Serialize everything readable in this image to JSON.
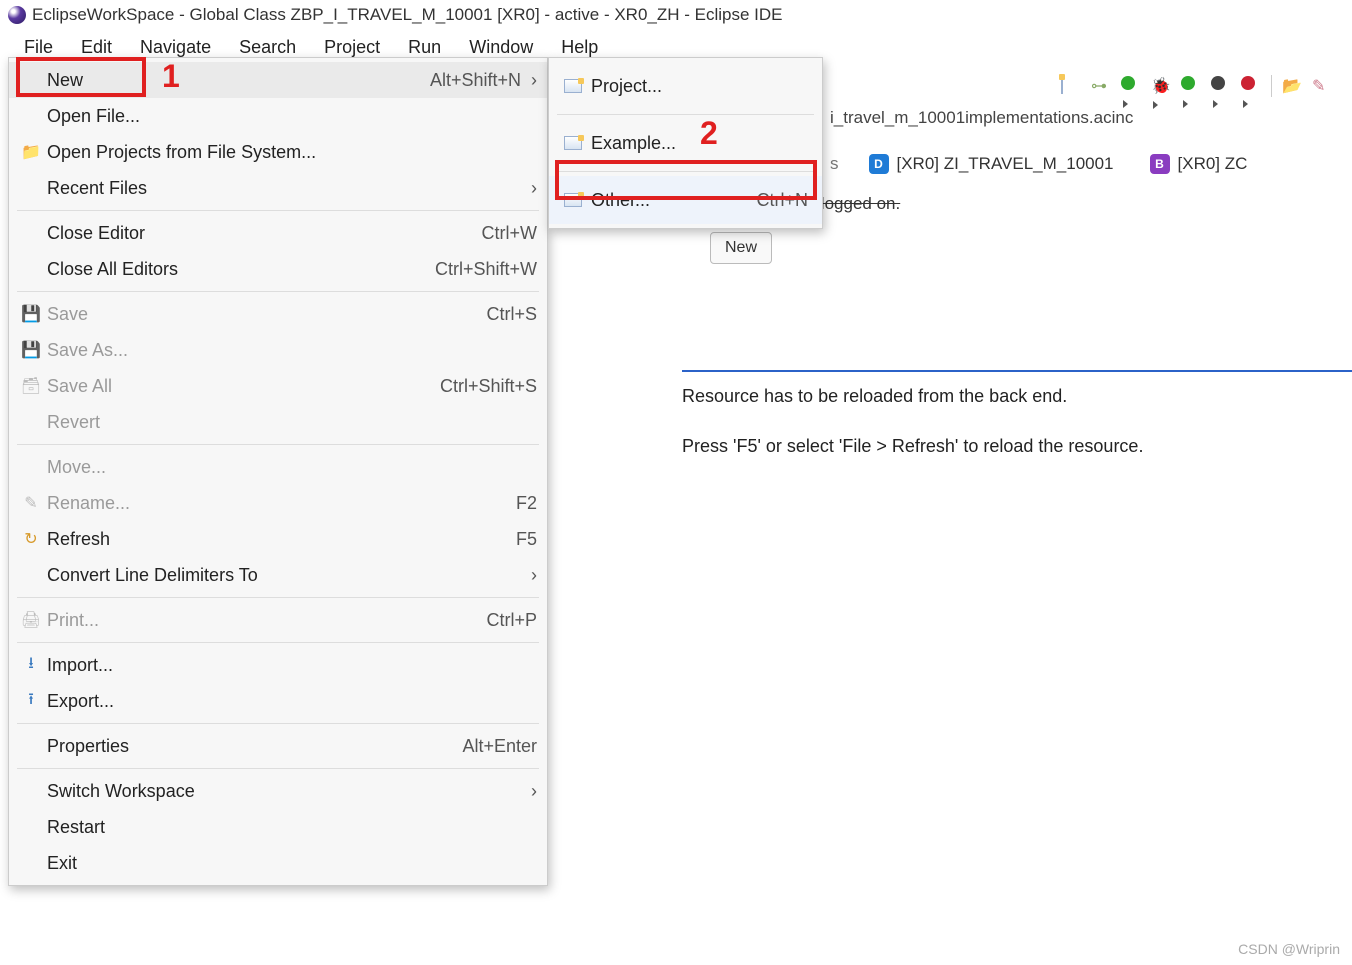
{
  "title_bar": "EclipseWorkSpace - Global Class ZBP_I_TRAVEL_M_10001 [XR0]  - active - XR0_ZH - Eclipse IDE",
  "menu_bar": [
    "File",
    "Edit",
    "Navigate",
    "Search",
    "Project",
    "Run",
    "Window",
    "Help"
  ],
  "file_menu": {
    "items": [
      {
        "icon": "",
        "label": "New",
        "shortcut": "Alt+Shift+N",
        "arrow": ">",
        "enabled": true,
        "highlight": true
      },
      {
        "icon": "",
        "label": "Open File...",
        "shortcut": "",
        "arrow": "",
        "enabled": true
      },
      {
        "icon": "folder",
        "label": "Open Projects from File System...",
        "shortcut": "",
        "arrow": "",
        "enabled": true
      },
      {
        "icon": "",
        "label": "Recent Files",
        "shortcut": "",
        "arrow": ">",
        "enabled": true
      },
      {
        "sep": true
      },
      {
        "icon": "",
        "label": "Close Editor",
        "shortcut": "Ctrl+W",
        "arrow": "",
        "enabled": true
      },
      {
        "icon": "",
        "label": "Close All Editors",
        "shortcut": "Ctrl+Shift+W",
        "arrow": "",
        "enabled": true
      },
      {
        "sep": true
      },
      {
        "icon": "save",
        "label": "Save",
        "shortcut": "Ctrl+S",
        "arrow": "",
        "enabled": false
      },
      {
        "icon": "saveas",
        "label": "Save As...",
        "shortcut": "",
        "arrow": "",
        "enabled": false
      },
      {
        "icon": "saveall",
        "label": "Save All",
        "shortcut": "Ctrl+Shift+S",
        "arrow": "",
        "enabled": false
      },
      {
        "icon": "",
        "label": "Revert",
        "shortcut": "",
        "arrow": "",
        "enabled": false
      },
      {
        "sep": true
      },
      {
        "icon": "",
        "label": "Move...",
        "shortcut": "",
        "arrow": "",
        "enabled": false
      },
      {
        "icon": "rename",
        "label": "Rename...",
        "shortcut": "F2",
        "arrow": "",
        "enabled": false
      },
      {
        "icon": "refresh",
        "label": "Refresh",
        "shortcut": "F5",
        "arrow": "",
        "enabled": true
      },
      {
        "icon": "",
        "label": "Convert Line Delimiters To",
        "shortcut": "",
        "arrow": ">",
        "enabled": true
      },
      {
        "sep": true
      },
      {
        "icon": "print",
        "label": "Print...",
        "shortcut": "Ctrl+P",
        "arrow": "",
        "enabled": false
      },
      {
        "sep": true
      },
      {
        "icon": "import",
        "label": "Import...",
        "shortcut": "",
        "arrow": "",
        "enabled": true
      },
      {
        "icon": "export",
        "label": "Export...",
        "shortcut": "",
        "arrow": "",
        "enabled": true
      },
      {
        "sep": true
      },
      {
        "icon": "",
        "label": "Properties",
        "shortcut": "Alt+Enter",
        "arrow": "",
        "enabled": true
      },
      {
        "sep": true
      },
      {
        "icon": "",
        "label": "Switch Workspace",
        "shortcut": "",
        "arrow": ">",
        "enabled": true
      },
      {
        "icon": "",
        "label": "Restart",
        "shortcut": "",
        "arrow": "",
        "enabled": true
      },
      {
        "icon": "",
        "label": "Exit",
        "shortcut": "",
        "arrow": "",
        "enabled": true
      }
    ]
  },
  "sub_menu": {
    "items": [
      {
        "label": "Project...",
        "shortcut": ""
      },
      {
        "sep": true
      },
      {
        "label": "Example...",
        "shortcut": ""
      },
      {
        "sep": true
      },
      {
        "label": "Other...",
        "shortcut": "Ctrl+N",
        "highlight": true
      }
    ]
  },
  "annotations": {
    "label1": "1",
    "label2": "2"
  },
  "breadcrumb": "i_travel_m_10001implementations.acinc",
  "tabs": [
    {
      "badge": "D",
      "color": "#1f7bd6",
      "label": "[XR0] ZI_TRAVEL_M_10001"
    },
    {
      "badge": "B",
      "color": "#8a3cc0",
      "label": "[XR0] ZC"
    }
  ],
  "status_msg": "Project is not logged on.",
  "new_button": "New",
  "body_line1": "Resource has to be reloaded from the back end.",
  "body_line2": "Press 'F5' or select 'File > Refresh' to reload the resource.",
  "footer": "CSDN @Wriprin",
  "tabs_leading_s": "s"
}
